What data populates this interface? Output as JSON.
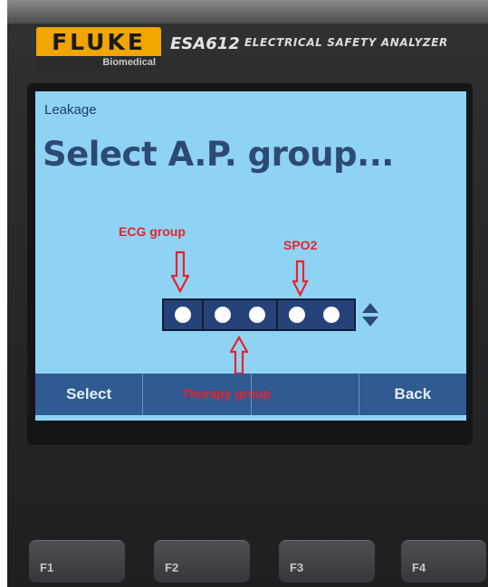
{
  "device": {
    "brand": "FLUKE",
    "brand_sub": "Biomedical",
    "model": "ESA612",
    "model_desc": "ELECTRICAL SAFETY ANALYZER"
  },
  "screen": {
    "label": "Leakage",
    "title": "Select A.P. group..."
  },
  "annotations": {
    "ecg": "ECG group",
    "spo2": "SPO2",
    "therapy": "Therapy group"
  },
  "softkeys": [
    "Select",
    "",
    "",
    "Back"
  ],
  "fkeys": [
    "F1",
    "F2",
    "F3",
    "F4"
  ],
  "colors": {
    "screen_bg": "#8fd3f4",
    "title": "#2d4a72",
    "softkey_bar": "#2f5a92",
    "annotation": "#e8232a",
    "brand_yellow": "#f0a500"
  },
  "icons": {
    "up_down": "up-down-arrows-icon",
    "annotation_arrow": "hollow-red-arrow"
  }
}
